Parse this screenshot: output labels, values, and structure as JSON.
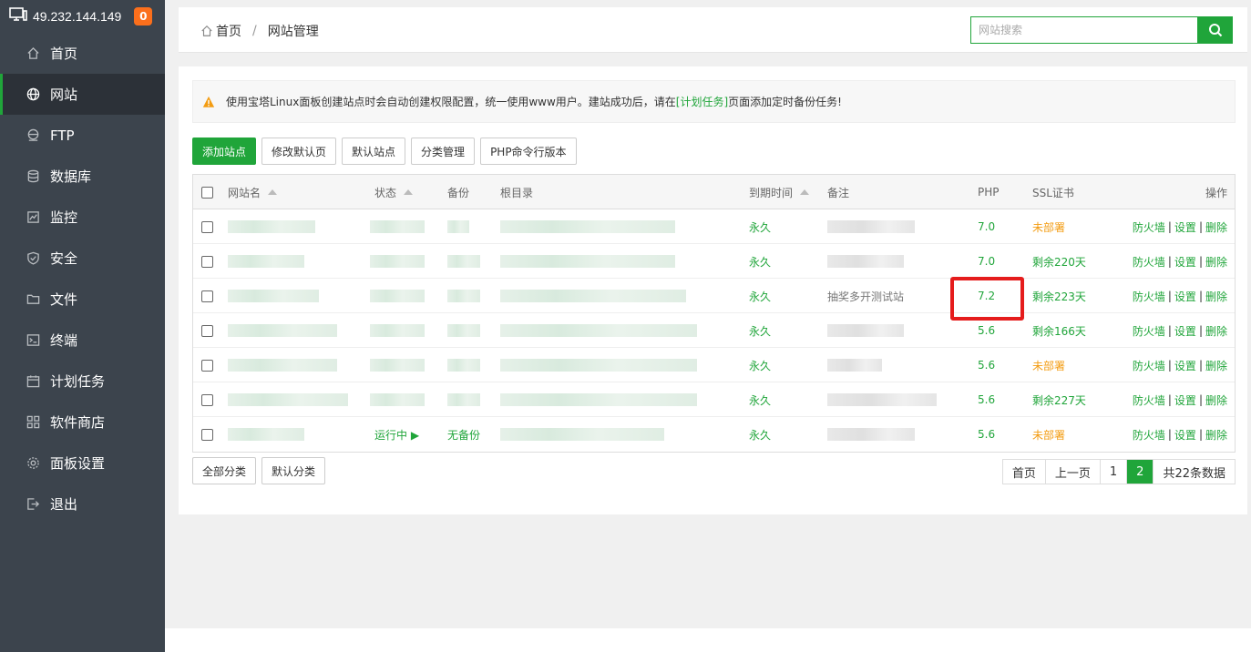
{
  "sidebar": {
    "ip": "49.232.144.149",
    "badge": "0",
    "items": [
      {
        "label": "首页"
      },
      {
        "label": "网站"
      },
      {
        "label": "FTP"
      },
      {
        "label": "数据库"
      },
      {
        "label": "监控"
      },
      {
        "label": "安全"
      },
      {
        "label": "文件"
      },
      {
        "label": "终端"
      },
      {
        "label": "计划任务"
      },
      {
        "label": "软件商店"
      },
      {
        "label": "面板设置"
      },
      {
        "label": "退出"
      }
    ]
  },
  "header": {
    "crumb_home": "首页",
    "crumb_sep": "/",
    "crumb_current": "网站管理",
    "search_placeholder": "网站搜索"
  },
  "notice": {
    "text_before": "使用宝塔Linux面板创建站点时会自动创建权限配置，统一使用www用户。建站成功后，请在",
    "link": "[计划任务]",
    "text_after": "页面添加定时备份任务!"
  },
  "toolbar": {
    "add_site": "添加站点",
    "edit_default": "修改默认页",
    "default_site": "默认站点",
    "category_manage": "分类管理",
    "php_cli": "PHP命令行版本"
  },
  "table": {
    "headers": {
      "name": "网站名",
      "status": "状态",
      "backup": "备份",
      "root": "根目录",
      "expire": "到期时间",
      "remark": "备注",
      "php": "PHP",
      "ssl": "SSL证书",
      "ops": "操作"
    },
    "rows": [
      {
        "expire": "永久",
        "remark": "",
        "php": "7.0",
        "ssl": "未部署",
        "ssl_state": "none"
      },
      {
        "expire": "永久",
        "remark": "",
        "php": "7.0",
        "ssl": "剩余220天",
        "ssl_state": "ok"
      },
      {
        "expire": "永久",
        "remark": "抽奖多开测试站",
        "php": "7.2",
        "ssl": "剩余223天",
        "ssl_state": "ok"
      },
      {
        "expire": "永久",
        "remark": "",
        "php": "5.6",
        "ssl": "剩余166天",
        "ssl_state": "ok"
      },
      {
        "expire": "永久",
        "remark": "",
        "php": "5.6",
        "ssl": "未部署",
        "ssl_state": "none"
      },
      {
        "expire": "永久",
        "remark": "",
        "php": "5.6",
        "ssl": "剩余227天",
        "ssl_state": "ok"
      },
      {
        "expire": "永久",
        "remark": "",
        "php": "5.6",
        "ssl": "未部署",
        "ssl_state": "none",
        "status": "运行中 ▶",
        "backup": "无备份"
      }
    ],
    "ops": {
      "firewall": "防火墙",
      "settings": "设置",
      "delete": "删除",
      "sep": "|"
    }
  },
  "footer_buttons": {
    "all_categories": "全部分类",
    "default_category": "默认分类"
  },
  "pager": {
    "first": "首页",
    "prev": "上一页",
    "page1": "1",
    "page2": "2",
    "total": "共22条数据"
  },
  "colors": {
    "accent": "#20a53a",
    "sidebar_bg": "#3c444d",
    "warning": "#f39c12",
    "highlight": "#e51c1c"
  }
}
